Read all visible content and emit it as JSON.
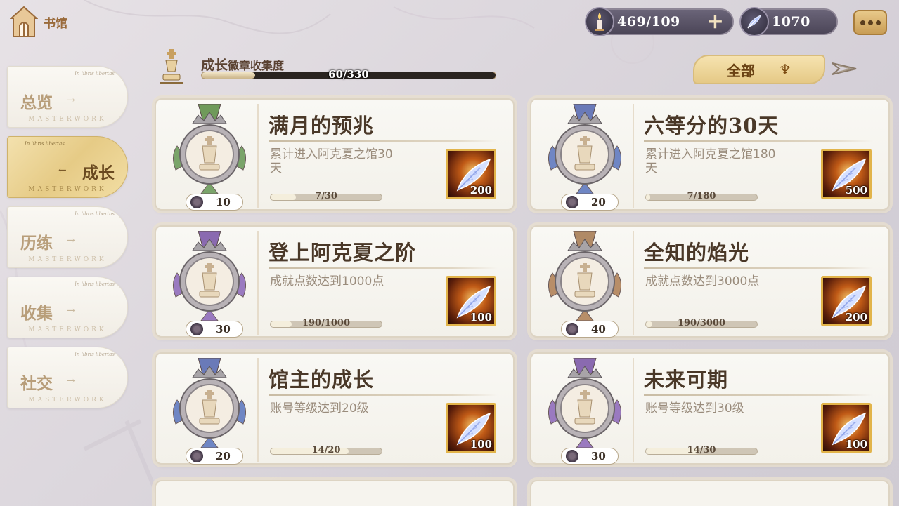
{
  "header": {
    "home_label": "书馆"
  },
  "currency": {
    "candle_value": "469/109",
    "plus_label": "+",
    "quill_value": "1070"
  },
  "sidebar": {
    "items": [
      {
        "label": "总览",
        "latin": "In libris libertas",
        "tag": "MASTERWORK",
        "active": false
      },
      {
        "label": "成长",
        "latin": "In libris libertas",
        "tag": "MASTERWORK",
        "active": true
      },
      {
        "label": "历练",
        "latin": "In libris libertas",
        "tag": "MASTERWORK",
        "active": false
      },
      {
        "label": "收集",
        "latin": "In libris libertas",
        "tag": "MASTERWORK",
        "active": false
      },
      {
        "label": "社交",
        "latin": "In libris libertas",
        "tag": "MASTERWORK",
        "active": false
      }
    ]
  },
  "progress": {
    "title_main": "成长",
    "title_sub": "徽章收集度",
    "text": "60/330",
    "fraction": 0.182
  },
  "filter": {
    "label": "全部"
  },
  "cards": [
    {
      "title": "满月的预兆",
      "desc": "累计进入阿克夏之馆30天",
      "level": "10",
      "progress": "7/30",
      "fraction": 0.233,
      "reward": "200",
      "ribbon": "#6f9a5a",
      "wing": "#7aa46a"
    },
    {
      "title": "六等分的30天",
      "desc": "累计进入阿克夏之馆180天",
      "level": "20",
      "progress": "7/180",
      "fraction": 0.039,
      "reward": "500",
      "ribbon": "#6a7ab8",
      "wing": "#6f86c4"
    },
    {
      "title": "登上阿克夏之阶",
      "desc": "成就点数达到1000点",
      "level": "30",
      "progress": "190/1000",
      "fraction": 0.19,
      "reward": "100",
      "ribbon": "#8a6ab0",
      "wing": "#9a7ac0"
    },
    {
      "title": "全知的焰光",
      "desc": "成就点数达到3000点",
      "level": "40",
      "progress": "190/3000",
      "fraction": 0.063,
      "reward": "200",
      "ribbon": "#b08a66",
      "wing": "#b88e68"
    },
    {
      "title": "馆主的成长",
      "desc": "账号等级达到20级",
      "level": "20",
      "progress": "14/20",
      "fraction": 0.7,
      "reward": "100",
      "ribbon": "#6a7ab8",
      "wing": "#6f86c4"
    },
    {
      "title": "未来可期",
      "desc": "账号等级达到30级",
      "level": "30",
      "progress": "14/30",
      "fraction": 0.467,
      "reward": "100",
      "ribbon": "#8a6ab0",
      "wing": "#9a7ac0"
    }
  ]
}
